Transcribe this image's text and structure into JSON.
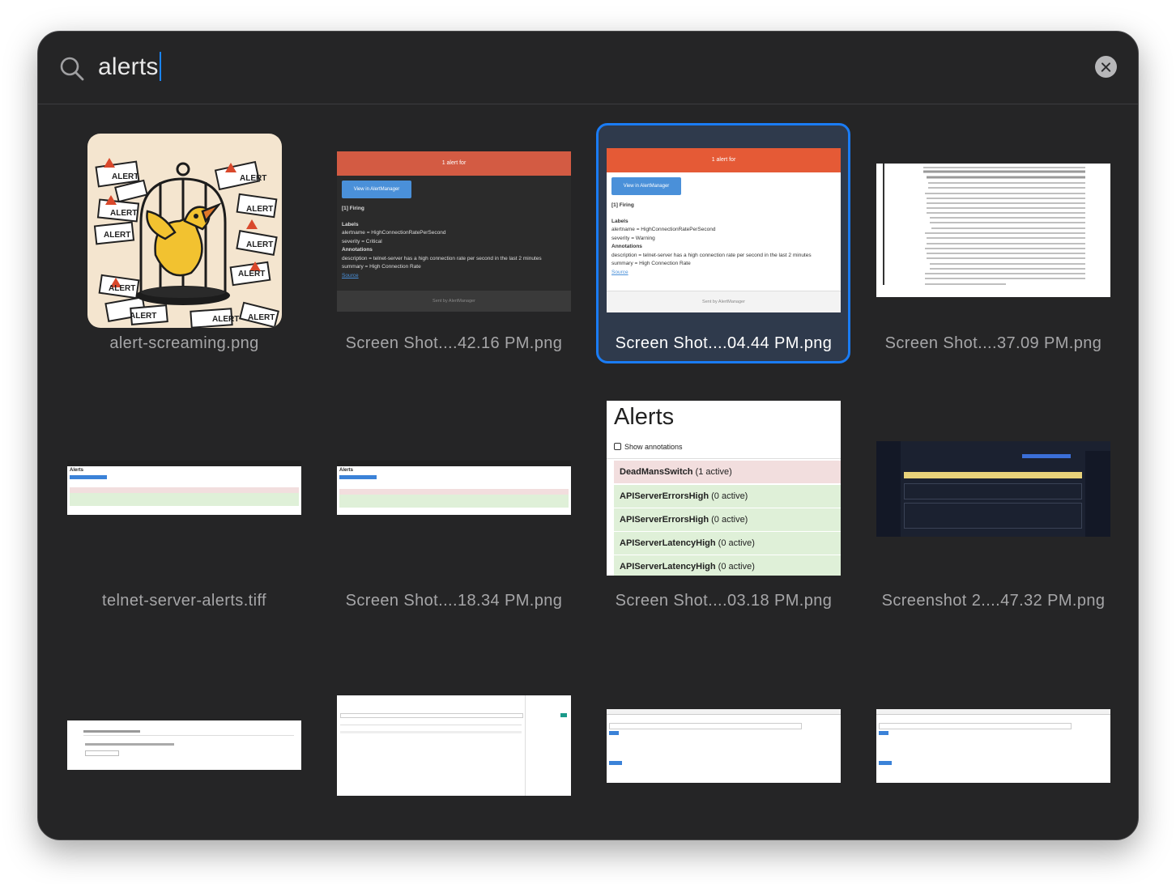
{
  "search": {
    "query": "alerts"
  },
  "results": [
    {
      "label": "alert-screaming.png",
      "thumb": {
        "signs": [
          "ALERT",
          "ALERT",
          "ALERT",
          "ALERT",
          "ALERT",
          "ALERT",
          "ALERT",
          "ALERT",
          "ALERT",
          "ALERT",
          "ALERT",
          "ALERT",
          "ALERT",
          "ALERT",
          "ALERT"
        ]
      }
    },
    {
      "label": "Screen Shot....42.16 PM.png",
      "thumb": {
        "header": "1 alert for",
        "button": "View in AlertManager",
        "firing": "[1] Firing",
        "labels_title": "Labels",
        "alertname": "alertname = HighConnectionRatePerSecond",
        "severity": "severity = Critical",
        "annotations_title": "Annotations",
        "description": "description = telnet-server has a high connection rate per second in the last 2 minutes",
        "summary": "summary = High Connection Rate",
        "source": "Source",
        "footer": "Sent by AlertManager"
      }
    },
    {
      "label": "Screen Shot....04.44 PM.png",
      "thumb": {
        "header": "1 alert for",
        "button": "View in AlertManager",
        "firing": "[1] Firing",
        "labels_title": "Labels",
        "alertname": "alertname = HighConnectionRatePerSecond",
        "severity": "severity = Warning",
        "annotations_title": "Annotations",
        "description": "description = telnet-server has a high connection rate per second in the last 2 minutes",
        "summary": "summary = High Connection Rate",
        "source": "Source",
        "footer": "Sent by AlertManager"
      }
    },
    {
      "label": "Screen Shot....37.09 PM.png",
      "thumb": {}
    },
    {
      "label": "telnet-server-alerts.tiff",
      "thumb": {
        "title": "Alerts"
      }
    },
    {
      "label": "Screen Shot....18.34 PM.png",
      "thumb": {
        "title": "Alerts"
      }
    },
    {
      "label": "Screen Shot....03.18 PM.png",
      "thumb": {
        "title": "Alerts",
        "checkbox": "Show annotations",
        "rows": [
          {
            "name": "DeadMansSwitch",
            "count": "(1 active)",
            "state": "firing"
          },
          {
            "name": "APIServerErrorsHigh",
            "count": "(0 active)",
            "state": "ok"
          },
          {
            "name": "APIServerErrorsHigh",
            "count": "(0 active)",
            "state": "ok"
          },
          {
            "name": "APIServerLatencyHigh",
            "count": "(0 active)",
            "state": "ok"
          },
          {
            "name": "APIServerLatencyHigh",
            "count": "(0 active)",
            "state": "ok"
          }
        ]
      }
    },
    {
      "label": "Screenshot 2....47.32 PM.png",
      "thumb": {}
    },
    {
      "label": "",
      "thumb": {}
    },
    {
      "label": "",
      "thumb": {}
    },
    {
      "label": "",
      "thumb": {}
    },
    {
      "label": "",
      "thumb": {}
    }
  ],
  "selected_index": 2,
  "colors": {
    "selection": "#1a7cf5",
    "panel": "#252526",
    "caret": "#1a84ff"
  }
}
